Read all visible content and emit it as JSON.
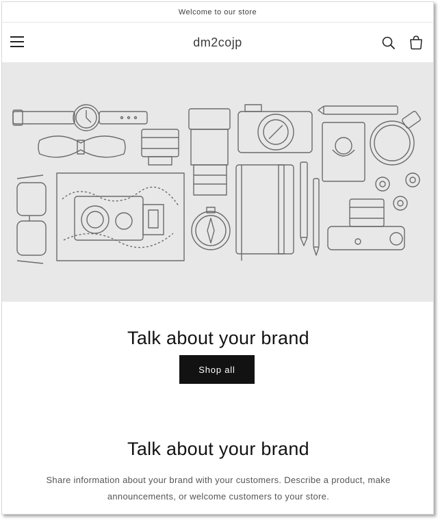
{
  "announcement": {
    "text": "Welcome to our store"
  },
  "header": {
    "logo": "dm2cojp",
    "icons": {
      "menu": "hamburger-icon",
      "search": "search-icon",
      "cart": "cart-icon"
    }
  },
  "hero": {
    "image_description_icon": "flat-lay-line-illustration",
    "heading": "Talk about your brand",
    "button_label": "Shop all"
  },
  "rich_text": {
    "heading": "Talk about your brand",
    "body": "Share information about your brand with your customers. Describe a product, make announcements, or welcome customers to your store."
  },
  "colors": {
    "hero_bg": "#e8e8e8",
    "button_bg": "#121212",
    "button_text": "#ffffff",
    "line_art": "#6a6a6a"
  }
}
